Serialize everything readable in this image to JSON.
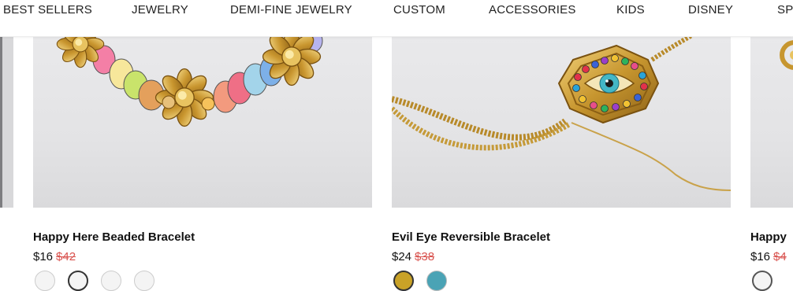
{
  "nav": {
    "items": [
      {
        "label": "BEST SELLERS"
      },
      {
        "label": "JEWELRY"
      },
      {
        "label": "DEMI-FINE JEWELRY"
      },
      {
        "label": "CUSTOM"
      },
      {
        "label": "ACCESSORIES"
      },
      {
        "label": "KIDS"
      },
      {
        "label": "DISNEY"
      },
      {
        "label": "SP"
      }
    ]
  },
  "products": [
    {
      "name": "Happy Here Beaded Bracelet",
      "price": "$16",
      "original_price": "$42",
      "swatches": [
        "#eeeeee",
        "#444444",
        "#eeeeee",
        "#eeeeee"
      ]
    },
    {
      "name": "Evil Eye Reversible Bracelet",
      "price": "$24",
      "original_price": "$38",
      "swatches": [
        "#c9a227",
        "#4aa3b5"
      ]
    },
    {
      "name": "Happy",
      "price": "$16",
      "original_price": "$4",
      "swatches": [
        "#555555"
      ]
    }
  ]
}
